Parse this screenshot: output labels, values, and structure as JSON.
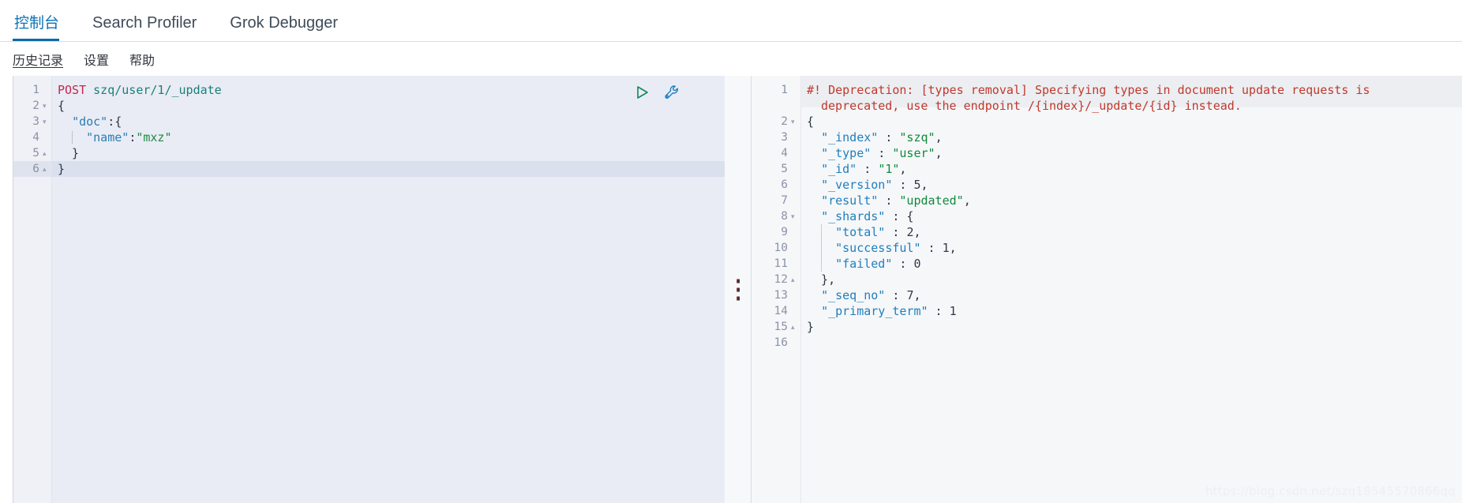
{
  "tabs": [
    {
      "label": "控制台",
      "active": true,
      "cjk": true
    },
    {
      "label": "Search Profiler",
      "active": false,
      "cjk": false
    },
    {
      "label": "Grok Debugger",
      "active": false,
      "cjk": false
    }
  ],
  "submenu": [
    {
      "label": "历史记录",
      "underlined": true
    },
    {
      "label": "设置",
      "underlined": false
    },
    {
      "label": "帮助",
      "underlined": false
    }
  ],
  "request_editor": {
    "actions": [
      {
        "name": "play-icon",
        "title": "发送请求"
      },
      {
        "name": "wrench-icon",
        "title": "工具"
      }
    ],
    "highlighted_line": 6,
    "lines": [
      {
        "n": 1,
        "fold": "",
        "indent": 0,
        "tokens": [
          {
            "t": "POST ",
            "c": "k-method"
          },
          {
            "t": "szq/user/1/_update",
            "c": "k-url"
          }
        ]
      },
      {
        "n": 2,
        "fold": "down",
        "indent": 0,
        "tokens": [
          {
            "t": "{",
            "c": "k-punct"
          }
        ]
      },
      {
        "n": 3,
        "fold": "down",
        "indent": 0,
        "tokens": [
          {
            "t": "  ",
            "c": "k-punct"
          },
          {
            "t": "\"doc\"",
            "c": "k-key"
          },
          {
            "t": ":{",
            "c": "k-punct"
          }
        ]
      },
      {
        "n": 4,
        "fold": "",
        "indent": 0,
        "tokens": [
          {
            "t": "    ",
            "c": "k-punct"
          },
          {
            "t": "\"name\"",
            "c": "k-key"
          },
          {
            "t": ":",
            "c": "k-punct"
          },
          {
            "t": "\"mxz\"",
            "c": "k-str"
          }
        ]
      },
      {
        "n": 5,
        "fold": "up",
        "indent": 0,
        "tokens": [
          {
            "t": "  }",
            "c": "k-punct"
          }
        ]
      },
      {
        "n": 6,
        "fold": "up",
        "indent": 0,
        "tokens": [
          {
            "t": "}",
            "c": "k-punct"
          }
        ]
      }
    ]
  },
  "response_editor": {
    "warning": {
      "line1": "#! Deprecation: [types removal] Specifying types in document update requests is",
      "line2": "deprecated, use the endpoint /{index}/_update/{id} instead."
    },
    "lines": [
      {
        "n": 2,
        "fold": "down",
        "tokens": [
          {
            "t": "{",
            "c": "k-punct"
          }
        ]
      },
      {
        "n": 3,
        "fold": "",
        "tokens": [
          {
            "t": "  ",
            "c": "k-punct"
          },
          {
            "t": "\"_index\"",
            "c": "k-resp-key"
          },
          {
            "t": " : ",
            "c": "k-punct"
          },
          {
            "t": "\"szq\"",
            "c": "k-resp-str"
          },
          {
            "t": ",",
            "c": "k-punct"
          }
        ]
      },
      {
        "n": 4,
        "fold": "",
        "tokens": [
          {
            "t": "  ",
            "c": "k-punct"
          },
          {
            "t": "\"_type\"",
            "c": "k-resp-key"
          },
          {
            "t": " : ",
            "c": "k-punct"
          },
          {
            "t": "\"user\"",
            "c": "k-resp-str"
          },
          {
            "t": ",",
            "c": "k-punct"
          }
        ]
      },
      {
        "n": 5,
        "fold": "",
        "tokens": [
          {
            "t": "  ",
            "c": "k-punct"
          },
          {
            "t": "\"_id\"",
            "c": "k-resp-key"
          },
          {
            "t": " : ",
            "c": "k-punct"
          },
          {
            "t": "\"1\"",
            "c": "k-resp-str"
          },
          {
            "t": ",",
            "c": "k-punct"
          }
        ]
      },
      {
        "n": 6,
        "fold": "",
        "tokens": [
          {
            "t": "  ",
            "c": "k-punct"
          },
          {
            "t": "\"_version\"",
            "c": "k-resp-key"
          },
          {
            "t": " : ",
            "c": "k-punct"
          },
          {
            "t": "5",
            "c": "k-resp-num"
          },
          {
            "t": ",",
            "c": "k-punct"
          }
        ]
      },
      {
        "n": 7,
        "fold": "",
        "tokens": [
          {
            "t": "  ",
            "c": "k-punct"
          },
          {
            "t": "\"result\"",
            "c": "k-resp-key"
          },
          {
            "t": " : ",
            "c": "k-punct"
          },
          {
            "t": "\"updated\"",
            "c": "k-resp-str"
          },
          {
            "t": ",",
            "c": "k-punct"
          }
        ]
      },
      {
        "n": 8,
        "fold": "down",
        "tokens": [
          {
            "t": "  ",
            "c": "k-punct"
          },
          {
            "t": "\"_shards\"",
            "c": "k-resp-key"
          },
          {
            "t": " : {",
            "c": "k-punct"
          }
        ]
      },
      {
        "n": 9,
        "fold": "",
        "tokens": [
          {
            "t": "    ",
            "c": "k-punct"
          },
          {
            "t": "\"total\"",
            "c": "k-resp-key"
          },
          {
            "t": " : ",
            "c": "k-punct"
          },
          {
            "t": "2",
            "c": "k-resp-num"
          },
          {
            "t": ",",
            "c": "k-punct"
          }
        ]
      },
      {
        "n": 10,
        "fold": "",
        "tokens": [
          {
            "t": "    ",
            "c": "k-punct"
          },
          {
            "t": "\"successful\"",
            "c": "k-resp-key"
          },
          {
            "t": " : ",
            "c": "k-punct"
          },
          {
            "t": "1",
            "c": "k-resp-num"
          },
          {
            "t": ",",
            "c": "k-punct"
          }
        ]
      },
      {
        "n": 11,
        "fold": "",
        "tokens": [
          {
            "t": "    ",
            "c": "k-punct"
          },
          {
            "t": "\"failed\"",
            "c": "k-resp-key"
          },
          {
            "t": " : ",
            "c": "k-punct"
          },
          {
            "t": "0",
            "c": "k-resp-num"
          }
        ]
      },
      {
        "n": 12,
        "fold": "up",
        "tokens": [
          {
            "t": "  },",
            "c": "k-punct"
          }
        ]
      },
      {
        "n": 13,
        "fold": "",
        "tokens": [
          {
            "t": "  ",
            "c": "k-punct"
          },
          {
            "t": "\"_seq_no\"",
            "c": "k-resp-key"
          },
          {
            "t": " : ",
            "c": "k-punct"
          },
          {
            "t": "7",
            "c": "k-resp-num"
          },
          {
            "t": ",",
            "c": "k-punct"
          }
        ]
      },
      {
        "n": 14,
        "fold": "",
        "tokens": [
          {
            "t": "  ",
            "c": "k-punct"
          },
          {
            "t": "\"_primary_term\"",
            "c": "k-resp-key"
          },
          {
            "t": " : ",
            "c": "k-punct"
          },
          {
            "t": "1",
            "c": "k-resp-num"
          }
        ]
      },
      {
        "n": 15,
        "fold": "up",
        "tokens": [
          {
            "t": "}",
            "c": "k-punct"
          }
        ]
      },
      {
        "n": 16,
        "fold": "",
        "tokens": []
      }
    ]
  },
  "watermark": "https://blog.csdn.net/szq18545570866qq",
  "colors": {
    "accent": "#0b6ba8",
    "editor_bg": "#e9ecf4",
    "response_bg": "#f6f7f9",
    "warning": "#c0392b",
    "string": "#1f8a42",
    "key": "#2a7cb8",
    "method": "#c7254e"
  }
}
